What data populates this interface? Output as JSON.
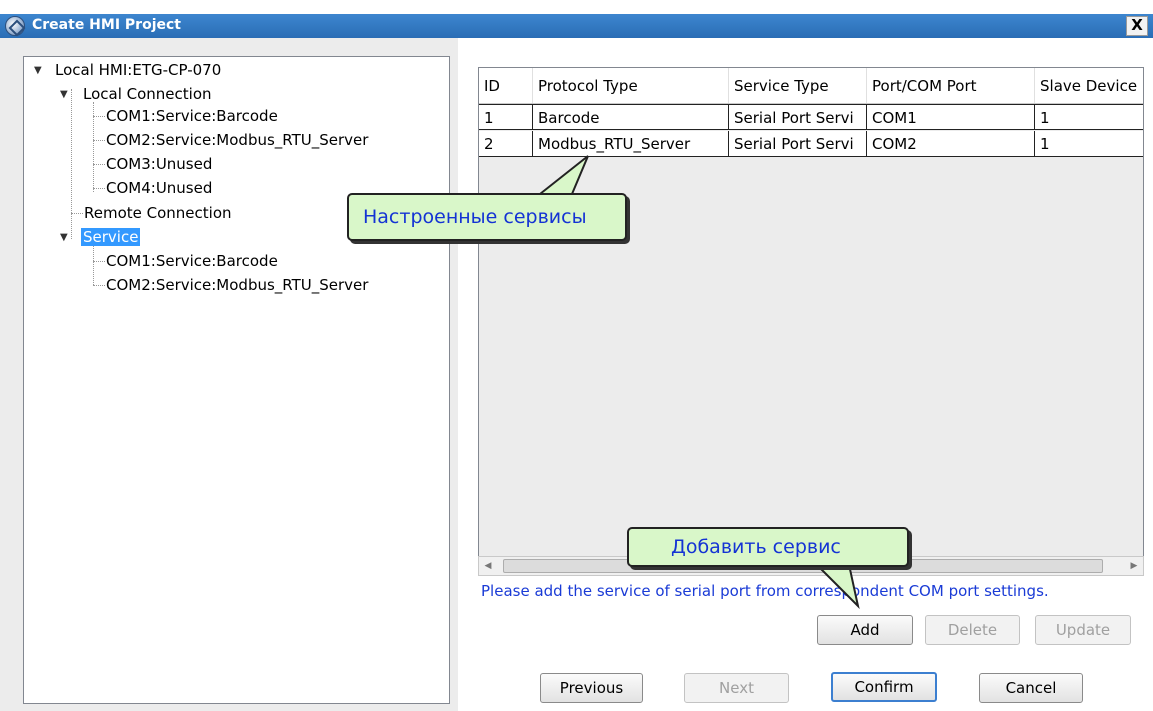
{
  "window": {
    "title": "Create HMI Project",
    "close_glyph": "X"
  },
  "tree": {
    "root": "Local HMI:ETG-CP-070",
    "local_connection": "Local Connection",
    "local_items": [
      "COM1:Service:Barcode",
      "COM2:Service:Modbus_RTU_Server",
      "COM3:Unused",
      "COM4:Unused"
    ],
    "remote_connection": "Remote Connection",
    "service": "Service",
    "service_items": [
      "COM1:Service:Barcode",
      "COM2:Service:Modbus_RTU_Server"
    ]
  },
  "table": {
    "columns": [
      "ID",
      "Protocol Type",
      "Service Type",
      "Port/COM Port",
      "Slave Device"
    ],
    "rows": [
      [
        "1",
        "Barcode",
        "Serial Port Servi",
        "COM1",
        "1"
      ],
      [
        "2",
        "Modbus_RTU_Server",
        "Serial Port Servi",
        "COM2",
        "1"
      ]
    ]
  },
  "hint": "Please add the service of serial port from correspondent COM port settings.",
  "buttons": {
    "add": "Add",
    "delete": "Delete",
    "update": "Update",
    "previous": "Previous",
    "next": "Next",
    "confirm": "Confirm",
    "cancel": "Cancel"
  },
  "callouts": {
    "configured_services": "Настроенные сервисы",
    "add_service": "Добавить сервис"
  },
  "colors": {
    "title_bar": "#2f74c0",
    "selection": "#3399ff",
    "callout_fill": "#d9f7c9",
    "callout_text": "#1433d4",
    "hint_text": "#1a3bd6"
  }
}
